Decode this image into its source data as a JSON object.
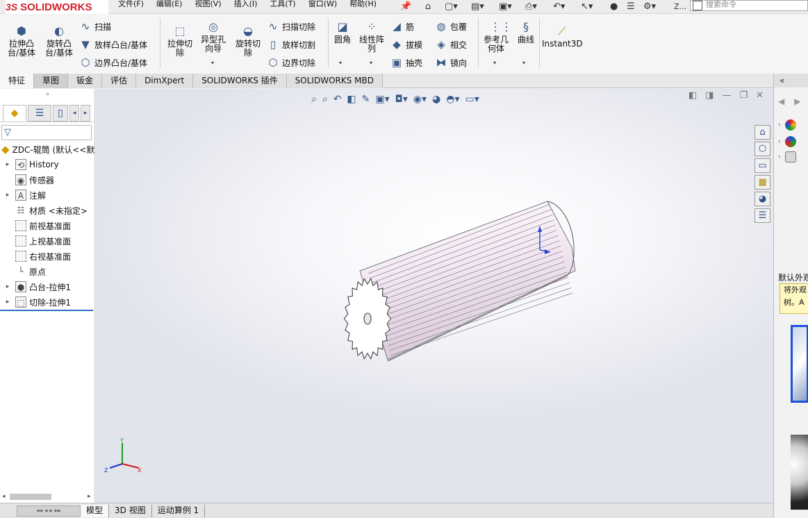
{
  "app": {
    "logo_prefix": "3S",
    "logo_text": "SOLIDWORKS"
  },
  "menu": [
    "文件(F)",
    "编辑(E)",
    "视图(V)",
    "插入(I)",
    "工具(T)",
    "窗口(W)",
    "帮助(H)"
  ],
  "quick_access": {
    "z_label": "Z...",
    "search_placeholder": "搜索命令"
  },
  "ribbon": {
    "extrude_boss": "拉伸凸\n台/基体",
    "revolve_boss": "旋转凸\n台/基体",
    "sweep": "扫描",
    "loft_boss": "放样凸台/基体",
    "boundary_boss": "边界凸台/基体",
    "extrude_cut": "拉伸切\n除",
    "hole_wizard": "异型孔\n向导",
    "revolve_cut": "旋转切\n除",
    "swept_cut": "扫描切除",
    "lofted_cut": "放样切割",
    "boundary_cut": "边界切除",
    "fillet": "圆角",
    "linear_pattern": "线性阵\n列",
    "rib": "筋",
    "wrap": "包覆",
    "draft": "拔模",
    "intersect": "相交",
    "shell": "抽壳",
    "mirror": "镜向",
    "reference_geometry": "参考几\n何体",
    "curves": "曲线",
    "instant3d": "Instant3D"
  },
  "tabs": [
    "特征",
    "草图",
    "钣金",
    "评估",
    "DimXpert",
    "SOLIDWORKS 插件",
    "SOLIDWORKS MBD"
  ],
  "tree": {
    "root": "ZDC-辊筒 (默认<<默认>",
    "items": [
      {
        "label": "History",
        "expandable": true,
        "icon": "history-icon"
      },
      {
        "label": "传感器",
        "expandable": false,
        "icon": "sensor-icon"
      },
      {
        "label": "注解",
        "expandable": true,
        "icon": "annotation-icon"
      },
      {
        "label": "材质 <未指定>",
        "expandable": false,
        "icon": "material-icon"
      },
      {
        "label": "前视基准面",
        "expandable": false,
        "icon": "plane-icon"
      },
      {
        "label": "上视基准面",
        "expandable": false,
        "icon": "plane-icon"
      },
      {
        "label": "右视基准面",
        "expandable": false,
        "icon": "plane-icon"
      },
      {
        "label": "原点",
        "expandable": false,
        "icon": "origin-icon"
      },
      {
        "label": "凸台-拉伸1",
        "expandable": true,
        "icon": "boss-extrude-icon"
      },
      {
        "label": "切除-拉伸1",
        "expandable": true,
        "icon": "cut-extrude-icon"
      }
    ]
  },
  "bottom_tabs": [
    "模型",
    "3D 视图",
    "运动算例 1"
  ],
  "task_pane": {
    "title": "默认外观",
    "tip_line1": "将外观",
    "tip_line2": "树。A"
  },
  "triad": {
    "x": "X",
    "y": "Y",
    "z": "Z"
  },
  "colors": {
    "accent_blue": "#1c4fe0",
    "logo_red": "#d0202a",
    "part_tint": "#efe3ef"
  }
}
